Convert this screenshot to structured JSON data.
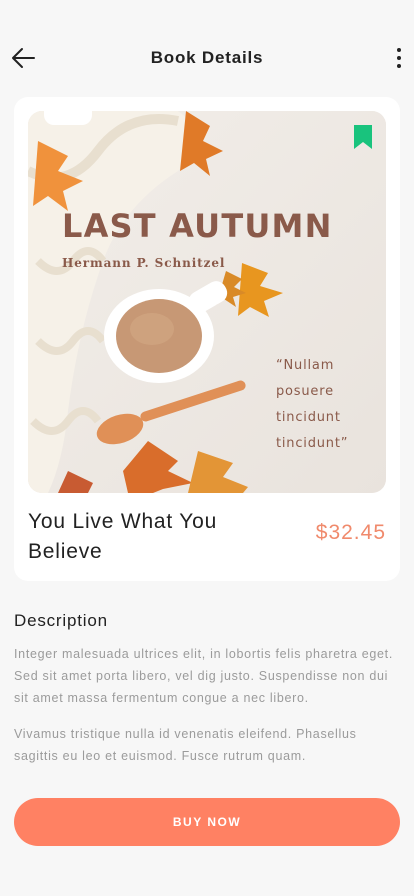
{
  "header": {
    "title": "Book Details",
    "back_icon": "arrow-left-icon",
    "more_icon": "more-vertical-icon"
  },
  "book": {
    "cover": {
      "title": "LAST AUTUMN",
      "author": "Hermann P. Schnitzel",
      "quote": "“Nullam posuere tincidunt tincidunt”",
      "bookmark_icon": "bookmark-icon",
      "bookmark_color": "#19c37d"
    },
    "title": "You Live What You Believe",
    "price": "$32.45",
    "price_color": "#f08a6c"
  },
  "description": {
    "heading": "Description",
    "paragraphs": [
      "Integer malesuada ultrices elit, in lobortis felis pharetra eget. Sed sit amet porta libero, vel dig justo. Suspendisse non dui sit amet massa fermentum congue a nec libero.",
      "Vivamus tristique nulla id venenatis eleifend. Phasellus sagittis eu leo et euismod. Fusce rutrum quam."
    ]
  },
  "actions": {
    "buy_label": "BUY NOW",
    "buy_color": "#ff8163"
  }
}
